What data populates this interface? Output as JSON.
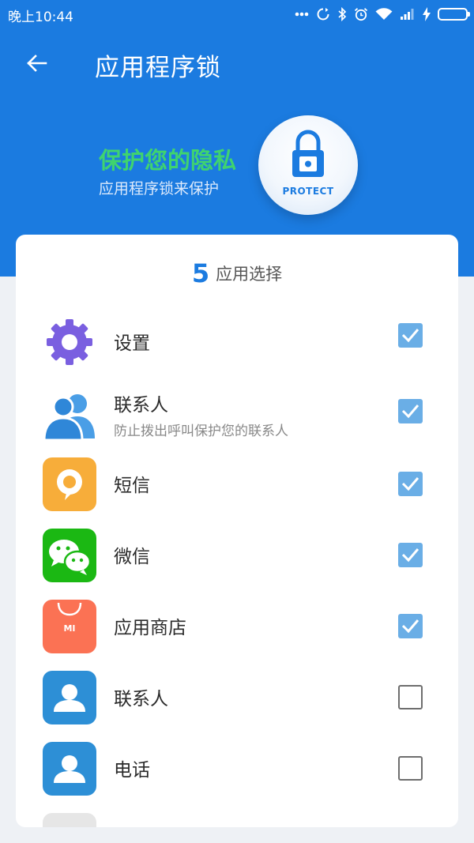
{
  "status_bar": {
    "time": "晚上10:44",
    "icons": [
      "more-dots-icon",
      "sync-icon",
      "bluetooth-icon",
      "alarm-icon",
      "wifi-icon",
      "signal-icon",
      "charging-icon",
      "battery-icon"
    ]
  },
  "app_bar": {
    "title": "应用程序锁",
    "back_icon": "arrow-left-icon"
  },
  "hero": {
    "title": "保护您的隐私",
    "subtitle": "应用程序锁来保护",
    "badge_label": "PROTECT"
  },
  "selection": {
    "count": "5",
    "label": "应用选择"
  },
  "apps": [
    {
      "name": "设置",
      "description": "",
      "icon": "settings-gear-icon",
      "checked": true
    },
    {
      "name": "联系人",
      "description": "防止拨出呼叫保护您的联系人",
      "icon": "contacts-people-icon",
      "checked": true
    },
    {
      "name": "短信",
      "description": "",
      "icon": "sms-bubble-icon",
      "checked": true
    },
    {
      "name": "微信",
      "description": "",
      "icon": "wechat-icon",
      "checked": true
    },
    {
      "name": "应用商店",
      "description": "",
      "icon": "mi-store-icon",
      "checked": true
    },
    {
      "name": "联系人",
      "description": "",
      "icon": "contact-person-icon",
      "checked": false
    },
    {
      "name": "电话",
      "description": "",
      "icon": "phone-person-icon",
      "checked": false
    }
  ],
  "mi_store_label": "MI",
  "colors": {
    "primary_blue": "#1b7be0",
    "hero_green": "#3fd36f",
    "checkbox_checked": "#6aaee6",
    "background": "#eef1f5"
  }
}
